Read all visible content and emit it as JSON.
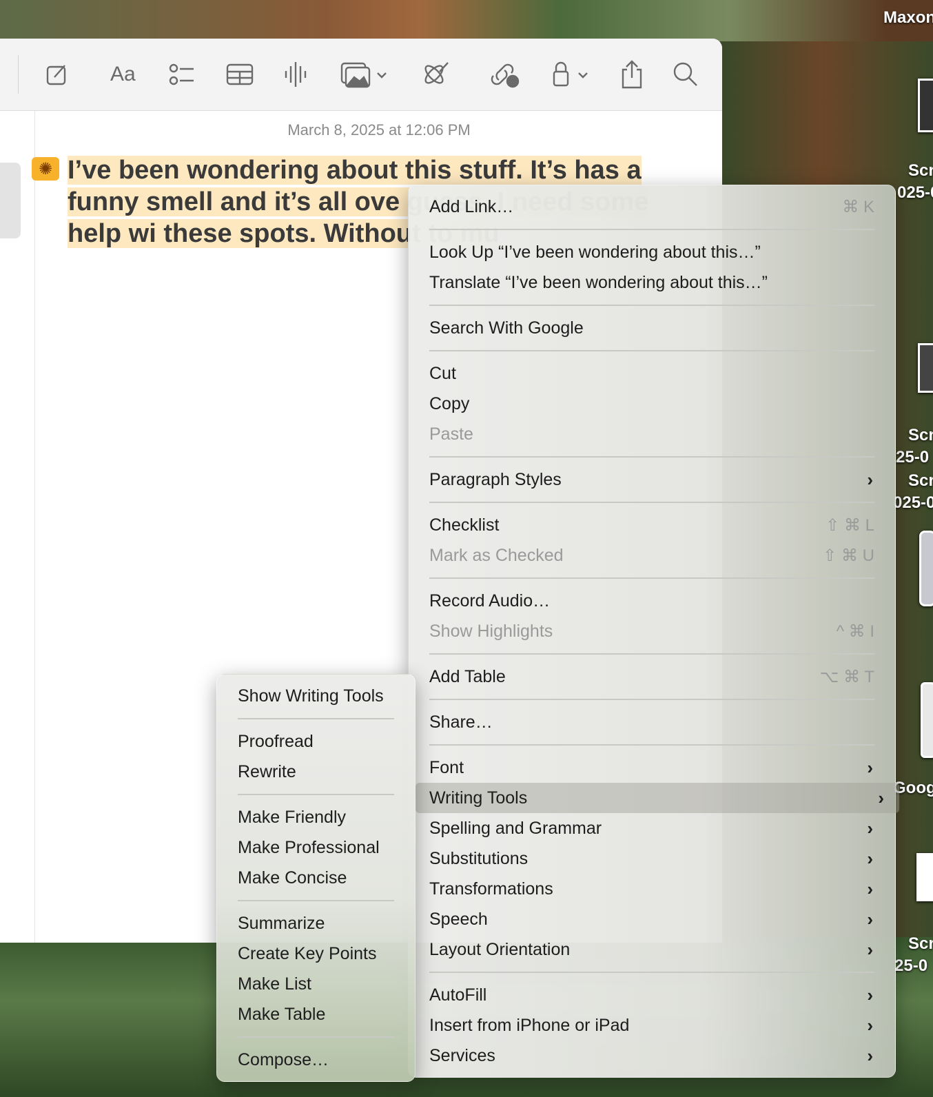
{
  "toolbar": {
    "icons": [
      "compose-icon",
      "format-text-icon",
      "checklist-icon",
      "table-icon",
      "audio-icon",
      "media-icon",
      "writing-tools-icon",
      "collaborate-icon",
      "lock-icon",
      "share-icon",
      "search-icon"
    ],
    "format_label": "Aa"
  },
  "note": {
    "date": "March 8, 2025 at 12:06 PM",
    "text": "I’ve been wondering about this stuff. It’s has a funny smell and it’s all ove guess, I need some help wi these spots. Without to mu"
  },
  "context_menu": [
    {
      "label": "Add Link…",
      "shortcut": "⌘ K"
    },
    "sep",
    {
      "label": "Look Up “I’ve been wondering about this…”"
    },
    {
      "label": "Translate “I’ve been wondering about this…”"
    },
    "sep",
    {
      "label": "Search With Google"
    },
    "sep",
    {
      "label": "Cut"
    },
    {
      "label": "Copy"
    },
    {
      "label": "Paste",
      "disabled": true
    },
    "sep",
    {
      "label": "Paragraph Styles",
      "submenu": true
    },
    "sep",
    {
      "label": "Checklist",
      "shortcut": "⇧ ⌘ L"
    },
    {
      "label": "Mark as Checked",
      "shortcut": "⇧ ⌘ U",
      "disabled": true
    },
    "sep",
    {
      "label": "Record Audio…"
    },
    {
      "label": "Show Highlights",
      "shortcut": "^ ⌘ I",
      "disabled": true
    },
    "sep",
    {
      "label": "Add Table",
      "shortcut": "⌥ ⌘ T"
    },
    "sep",
    {
      "label": "Share…"
    },
    "sep",
    {
      "label": "Font",
      "submenu": true
    },
    {
      "label": "Writing Tools",
      "submenu": true,
      "highlighted": true
    },
    {
      "label": "Spelling and Grammar",
      "submenu": true
    },
    {
      "label": "Substitutions",
      "submenu": true
    },
    {
      "label": "Transformations",
      "submenu": true
    },
    {
      "label": "Speech",
      "submenu": true
    },
    {
      "label": "Layout Orientation",
      "submenu": true
    },
    "sep",
    {
      "label": "AutoFill",
      "submenu": true
    },
    {
      "label": "Insert from iPhone or iPad",
      "submenu": true
    },
    {
      "label": "Services",
      "submenu": true
    }
  ],
  "writing_tools_menu": [
    {
      "label": "Show Writing Tools"
    },
    "sep",
    {
      "label": "Proofread"
    },
    {
      "label": "Rewrite"
    },
    "sep",
    {
      "label": "Make Friendly"
    },
    {
      "label": "Make Professional"
    },
    {
      "label": "Make Concise"
    },
    "sep",
    {
      "label": "Summarize"
    },
    {
      "label": "Create Key Points"
    },
    {
      "label": "Make List"
    },
    {
      "label": "Make Table"
    },
    "sep",
    {
      "label": "Compose…"
    }
  ],
  "desktop": {
    "labels": [
      "Maxon",
      "Scr",
      "025-0",
      "Scr",
      "25-0",
      "Scr",
      "025-0",
      "Goog",
      "Scr",
      "25-0"
    ]
  }
}
